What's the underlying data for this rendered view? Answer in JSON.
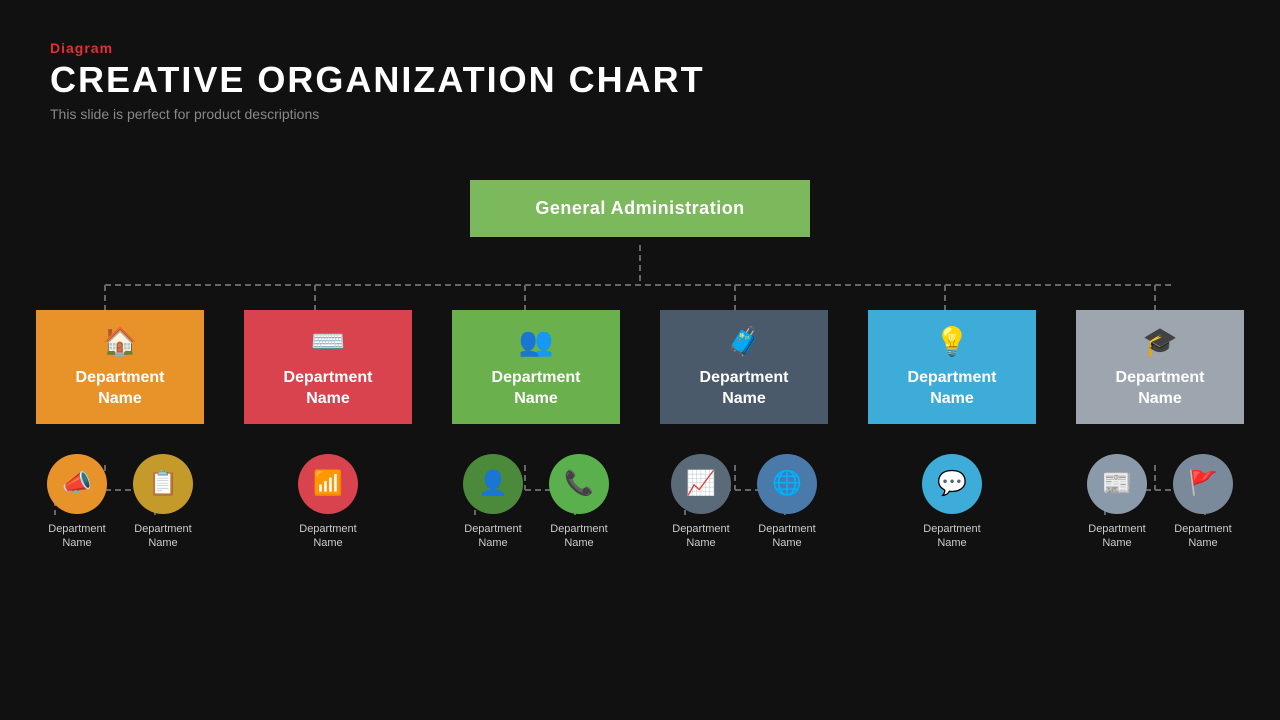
{
  "header": {
    "diagram_label": "Diagram",
    "title": "CREATIVE ORGANIZATION CHART",
    "subtitle": "This slide is perfect for product descriptions"
  },
  "top_node": {
    "label": "General Administration"
  },
  "departments": [
    {
      "id": "dept-1",
      "color": "orange",
      "icon": "🏠",
      "label": "Department\nName",
      "sub_items": [
        {
          "color": "orange",
          "icon": "📣",
          "label": "Department\nName"
        },
        {
          "color": "olive",
          "icon": "📋",
          "label": "Department\nName"
        }
      ]
    },
    {
      "id": "dept-2",
      "color": "red",
      "icon": "⌨",
      "label": "Department\nName",
      "sub_items": [
        {
          "color": "red",
          "icon": "📶",
          "label": "Department\nName"
        }
      ]
    },
    {
      "id": "dept-3",
      "color": "green",
      "icon": "👥",
      "label": "Department\nName",
      "sub_items": [
        {
          "color": "green-dark",
          "icon": "👤",
          "label": "Department\nName"
        },
        {
          "color": "green-light",
          "icon": "📞",
          "label": "Department\nName"
        }
      ]
    },
    {
      "id": "dept-4",
      "color": "dark",
      "icon": "🧳",
      "label": "Department\nName",
      "sub_items": [
        {
          "color": "dark-gray",
          "icon": "📈",
          "label": "Department\nName"
        },
        {
          "color": "dark-blue",
          "icon": "🌐",
          "label": "Department\nName"
        }
      ]
    },
    {
      "id": "dept-5",
      "color": "blue",
      "icon": "💡",
      "label": "Department\nName",
      "sub_items": [
        {
          "color": "blue",
          "icon": "💬",
          "label": "Department\nName"
        }
      ]
    },
    {
      "id": "dept-6",
      "color": "gray",
      "icon": "🎓",
      "label": "Department\nName",
      "sub_items": [
        {
          "color": "gray",
          "icon": "📰",
          "label": "Department\nName"
        },
        {
          "color": "gray-dark",
          "icon": "🚩",
          "label": "Department\nName"
        }
      ]
    }
  ]
}
